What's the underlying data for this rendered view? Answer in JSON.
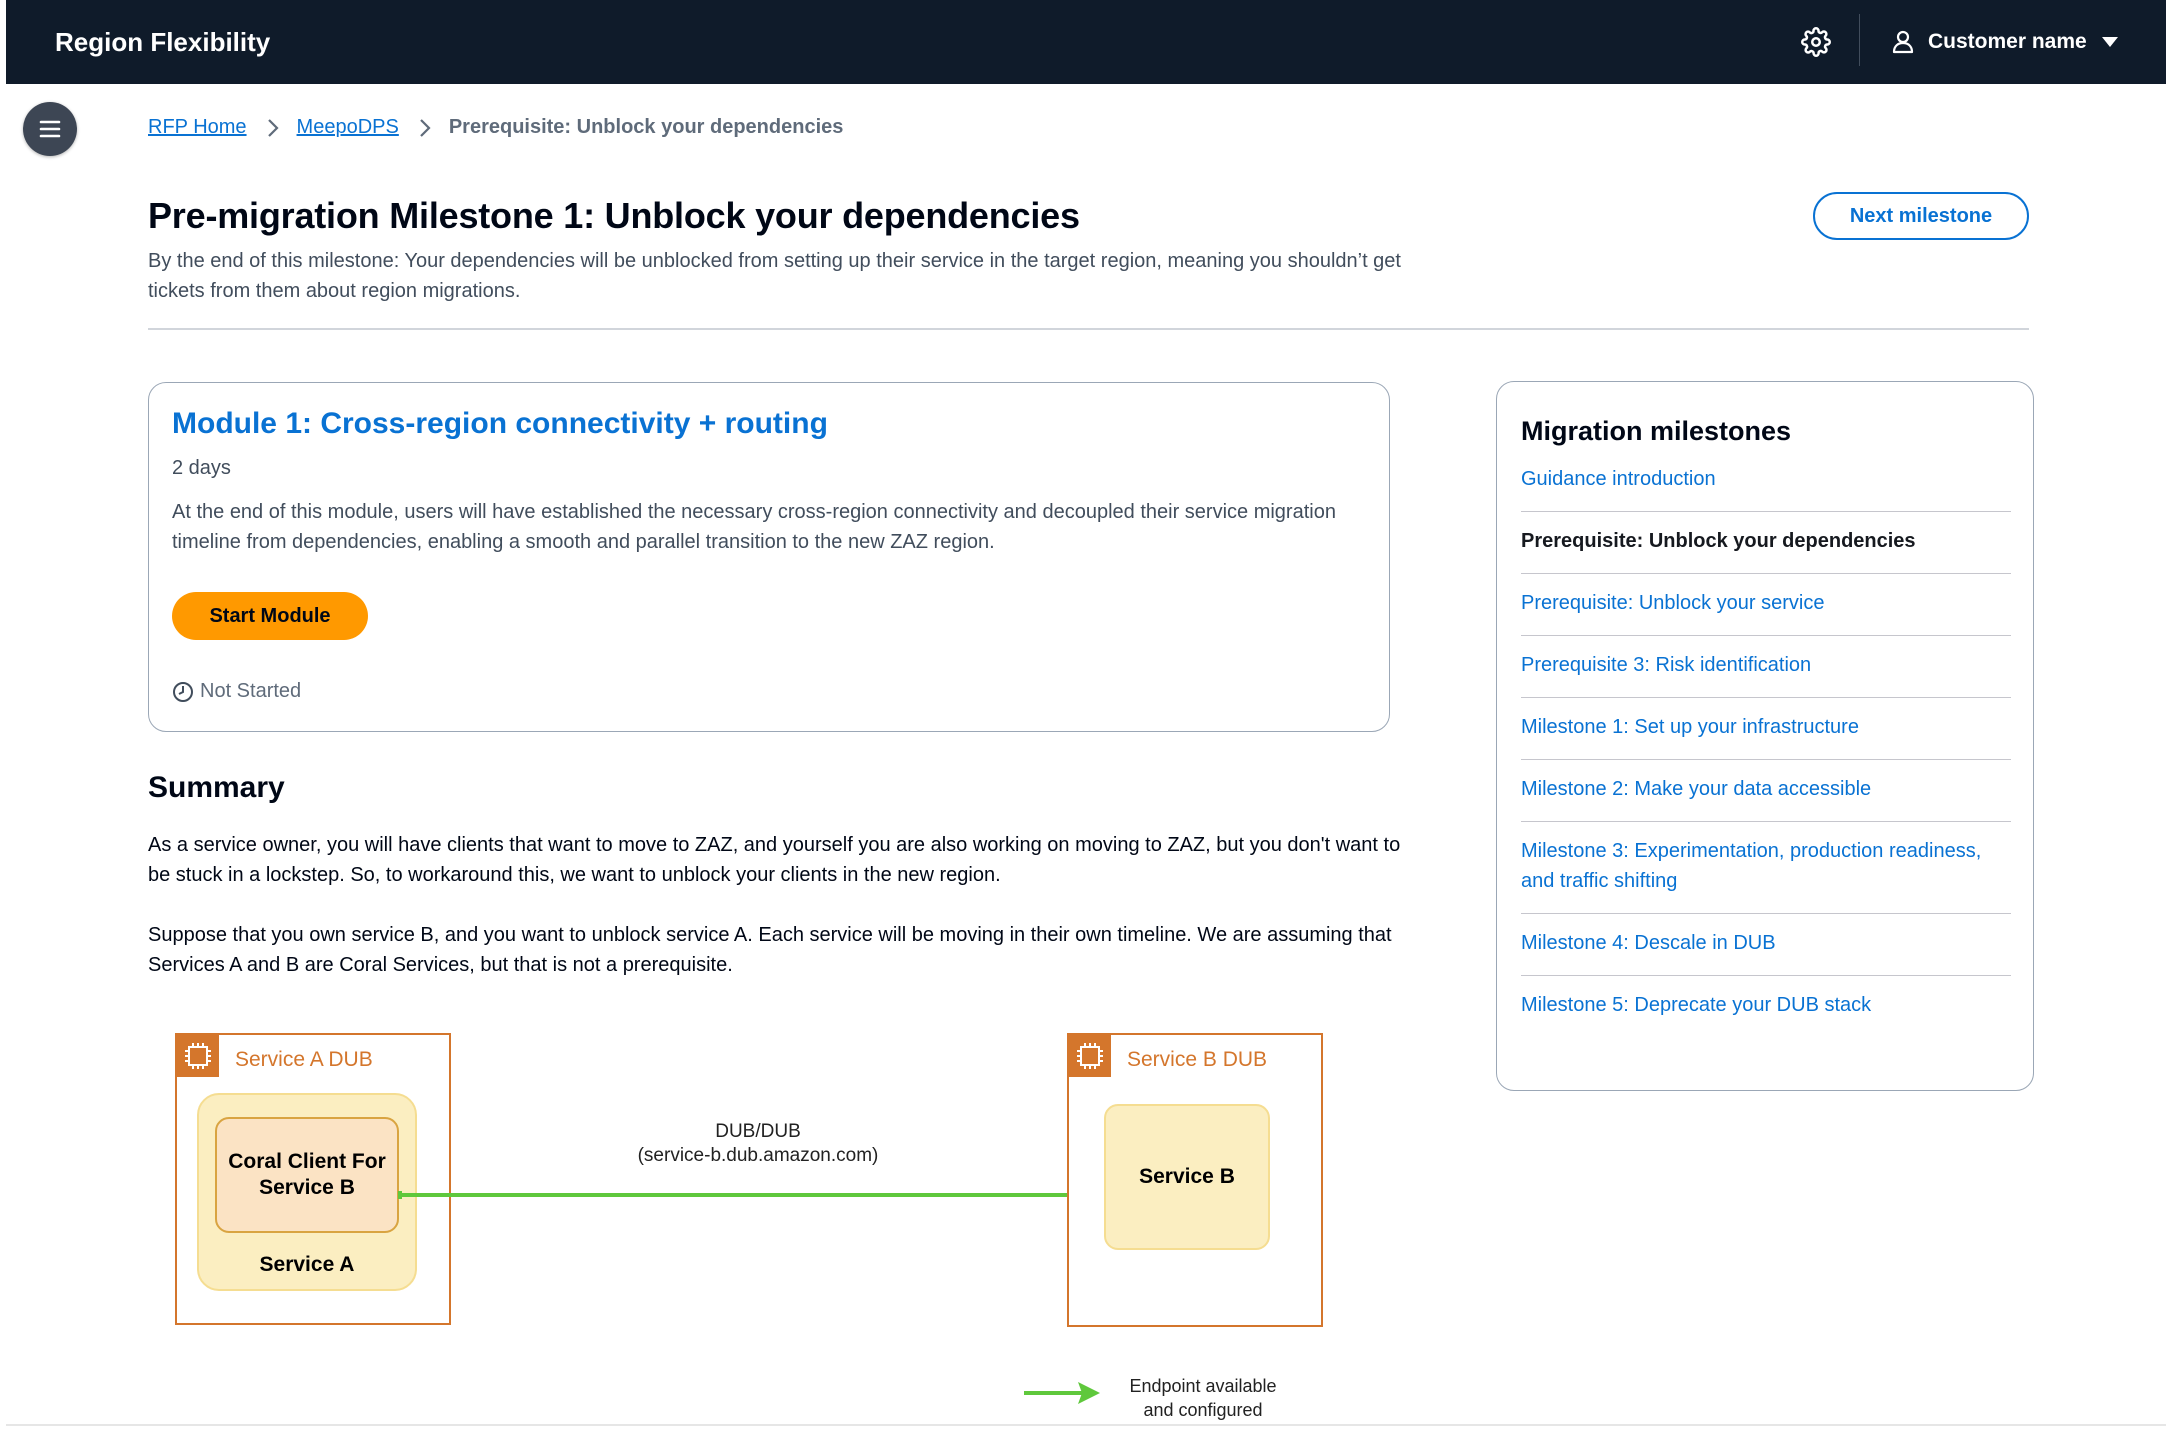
{
  "app": {
    "title": "Region Flexibility",
    "user_name": "Customer name"
  },
  "icons": {
    "settings": "gear-icon",
    "user": "user-icon",
    "menu": "hamburger-icon",
    "status": "clock-icon"
  },
  "breadcrumb": {
    "items": [
      "RFP Home",
      "MeepoDPS"
    ],
    "current": "Prerequisite: Unblock your dependencies"
  },
  "header": {
    "title": "Pre-migration Milestone 1: Unblock your dependencies",
    "description": "By the end of this milestone: Your dependencies will be unblocked from setting up their service in the target region, meaning you shouldn’t get tickets from them about region migrations.",
    "next_label": "Next milestone"
  },
  "module": {
    "title": "Module 1: Cross-region connectivity + routing",
    "duration": "2 days",
    "description": "At the end of this module, users will have established the necessary cross-region connectivity and decoupled their service migration timeline from dependencies, enabling a smooth and parallel transition to the new ZAZ region.",
    "start_label": "Start Module",
    "status": "Not Started"
  },
  "summary": {
    "heading": "Summary",
    "p1": "As a service owner, you will have clients that want to move to ZAZ, and yourself you are also working on moving to ZAZ, but you don't want to be stuck in a lockstep. So, to workaround this, we want to unblock your clients in the new region.",
    "p2": "Suppose that you own service B, and you want to unblock service A. Each service will be moving in their own timeline. We are assuming that Services A and B are Coral Services, but that is not a prerequisite."
  },
  "diagram": {
    "service_a_region": "Service A DUB",
    "client_label": "Coral Client For Service B",
    "service_a": "Service A",
    "service_b_region": "Service B DUB",
    "service_b": "Service B",
    "edge_label_1": "DUB/DUB",
    "edge_label_2": "(service-b.dub.amazon.com)",
    "legend_1": "Endpoint available",
    "legend_2": "and configured",
    "colors": {
      "region": "#d4762c",
      "arrow": "#5fc83c",
      "service_fill": "#fbeec1",
      "client_fill": "#fbe3c4"
    }
  },
  "milestones": {
    "title": "Migration milestones",
    "items": [
      "Guidance introduction",
      "Prerequisite: Unblock your dependencies",
      "Prerequisite: Unblock your service",
      "Prerequisite 3: Risk identification",
      "Milestone 1: Set up your infrastructure",
      "Milestone 2: Make your data accessible",
      "Milestone 3: Experimentation, production readiness, and traffic shifting",
      "Milestone 4: Descale in DUB",
      "Milestone 5: Deprecate your DUB stack"
    ]
  }
}
